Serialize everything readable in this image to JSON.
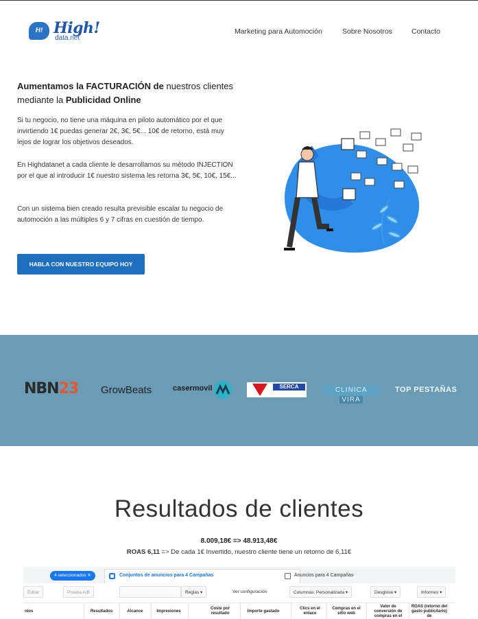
{
  "header": {
    "logo": {
      "badge": "H!",
      "name": "High!",
      "sub": "data",
      "sub_suffix": ".net"
    },
    "nav": [
      "Marketing para Automoción",
      "Sobre Nosotros",
      "Contacto"
    ]
  },
  "hero": {
    "title_1": "Aumentamos la",
    "title_2": "FACTURACIÓN",
    "title_3": "de",
    "title_4": "nuestros clientes mediante la",
    "title_5": "Publicidad Online",
    "paragraphs": [
      "Si tu negocio, no tiene una máquina en piloto automático por el que invirtiendo 1€ puedas generar 2€, 3€, 5€... 10€ de retorno, está muy lejos de lograr los objetivos deseados.",
      "En Highdatanet a cada cliente le desarrollamos su método INJECTION por el que al introducir 1€ nuestro sistema les retorna 3€, 5€, 10€, 15€...",
      "Con un sistema bien creado resulta previsible escalar tu negocio de automoción a las múltiples 6 y 7 cifras en cuestión de tiempo."
    ],
    "cta": "HABLA CON NUESTRO EQUIPO HOY"
  },
  "brands": {
    "nbn_1": "NBN",
    "nbn_2": "23",
    "growbeats": "GrowBeats",
    "casermovil": "casermovil",
    "serca": "SERCA",
    "clinica_1": "CLINICA",
    "clinica_2": "VIRA",
    "pestanas_1": "TOP",
    "pestanas_2": "PESTAÑAS"
  },
  "results": {
    "title": "Resultados de clientes",
    "line1": "8.009,18€ => 48.913,48€",
    "line2_bold": "ROAS 6,11",
    "line2_rest": " => De cada 1€ Invertido, nuestro cliente tiene un retorno de 6,11€"
  },
  "ads_screenshot": {
    "selected": "4 seleccionados ✕",
    "tab_main": "Conjuntos de anuncios para 4 Campañas",
    "tab_second": "Anuncios para 4 Campañas",
    "toolbar": [
      "Editar",
      "Prueba A/B",
      "Reglas ▾",
      "Ver configuración",
      "Columnas: Personalizada ▾",
      "Desglose ▾",
      "Informes ▾"
    ],
    "columns": [
      "nios",
      "Resultados",
      "Alcance",
      "Impresiones",
      "Coste por resultado",
      "Importe gastado",
      "Clics en el enlace",
      "Compras en el sitio web",
      "Valor de conversión de compras en el",
      "ROAS (retorno del gasto publicitario) de"
    ]
  },
  "colors": {
    "accent": "#1e6fc0",
    "band": "#6a9cb6",
    "nbn_highlight": "#e8562a"
  }
}
